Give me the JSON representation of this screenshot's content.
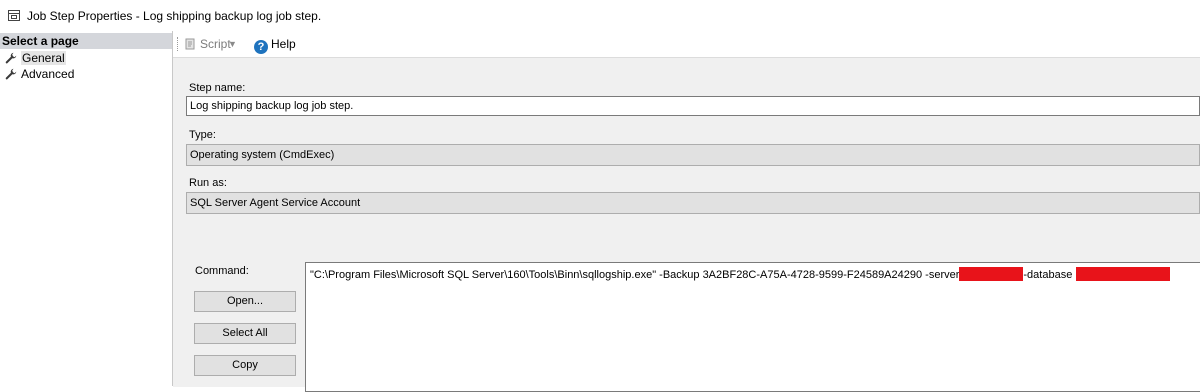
{
  "window": {
    "title": "Job Step Properties - Log shipping backup log job step."
  },
  "left_pane": {
    "header": "Select a page",
    "pages": [
      {
        "label": "General",
        "icon": "wrench-icon",
        "selected": true
      },
      {
        "label": "Advanced",
        "icon": "wrench-icon",
        "selected": false
      }
    ]
  },
  "toolbar": {
    "script_label": "Script",
    "script_enabled": false,
    "help_label": "Help"
  },
  "form": {
    "step_name_label": "Step name:",
    "step_name_value": "Log shipping backup log job step.",
    "type_label": "Type:",
    "type_value": "Operating system (CmdExec)",
    "run_as_label": "Run as:",
    "run_as_value": "SQL Server Agent Service Account",
    "command_label": "Command:",
    "command_text": "\"C:\\Program Files\\Microsoft SQL Server\\160\\Tools\\Binn\\sqllogship.exe\" -Backup 3A2BF28C-A75A-4728-9599-F24589A24290 -server",
    "command_database_flag": "-database",
    "buttons": {
      "open": "Open...",
      "select_all": "Select All",
      "copy": "Copy"
    }
  },
  "colors": {
    "redaction": "#e8131a",
    "help_icon": "#1e73be",
    "content_background": "#f0f0f0",
    "page_header_background": "#d4d6db"
  }
}
